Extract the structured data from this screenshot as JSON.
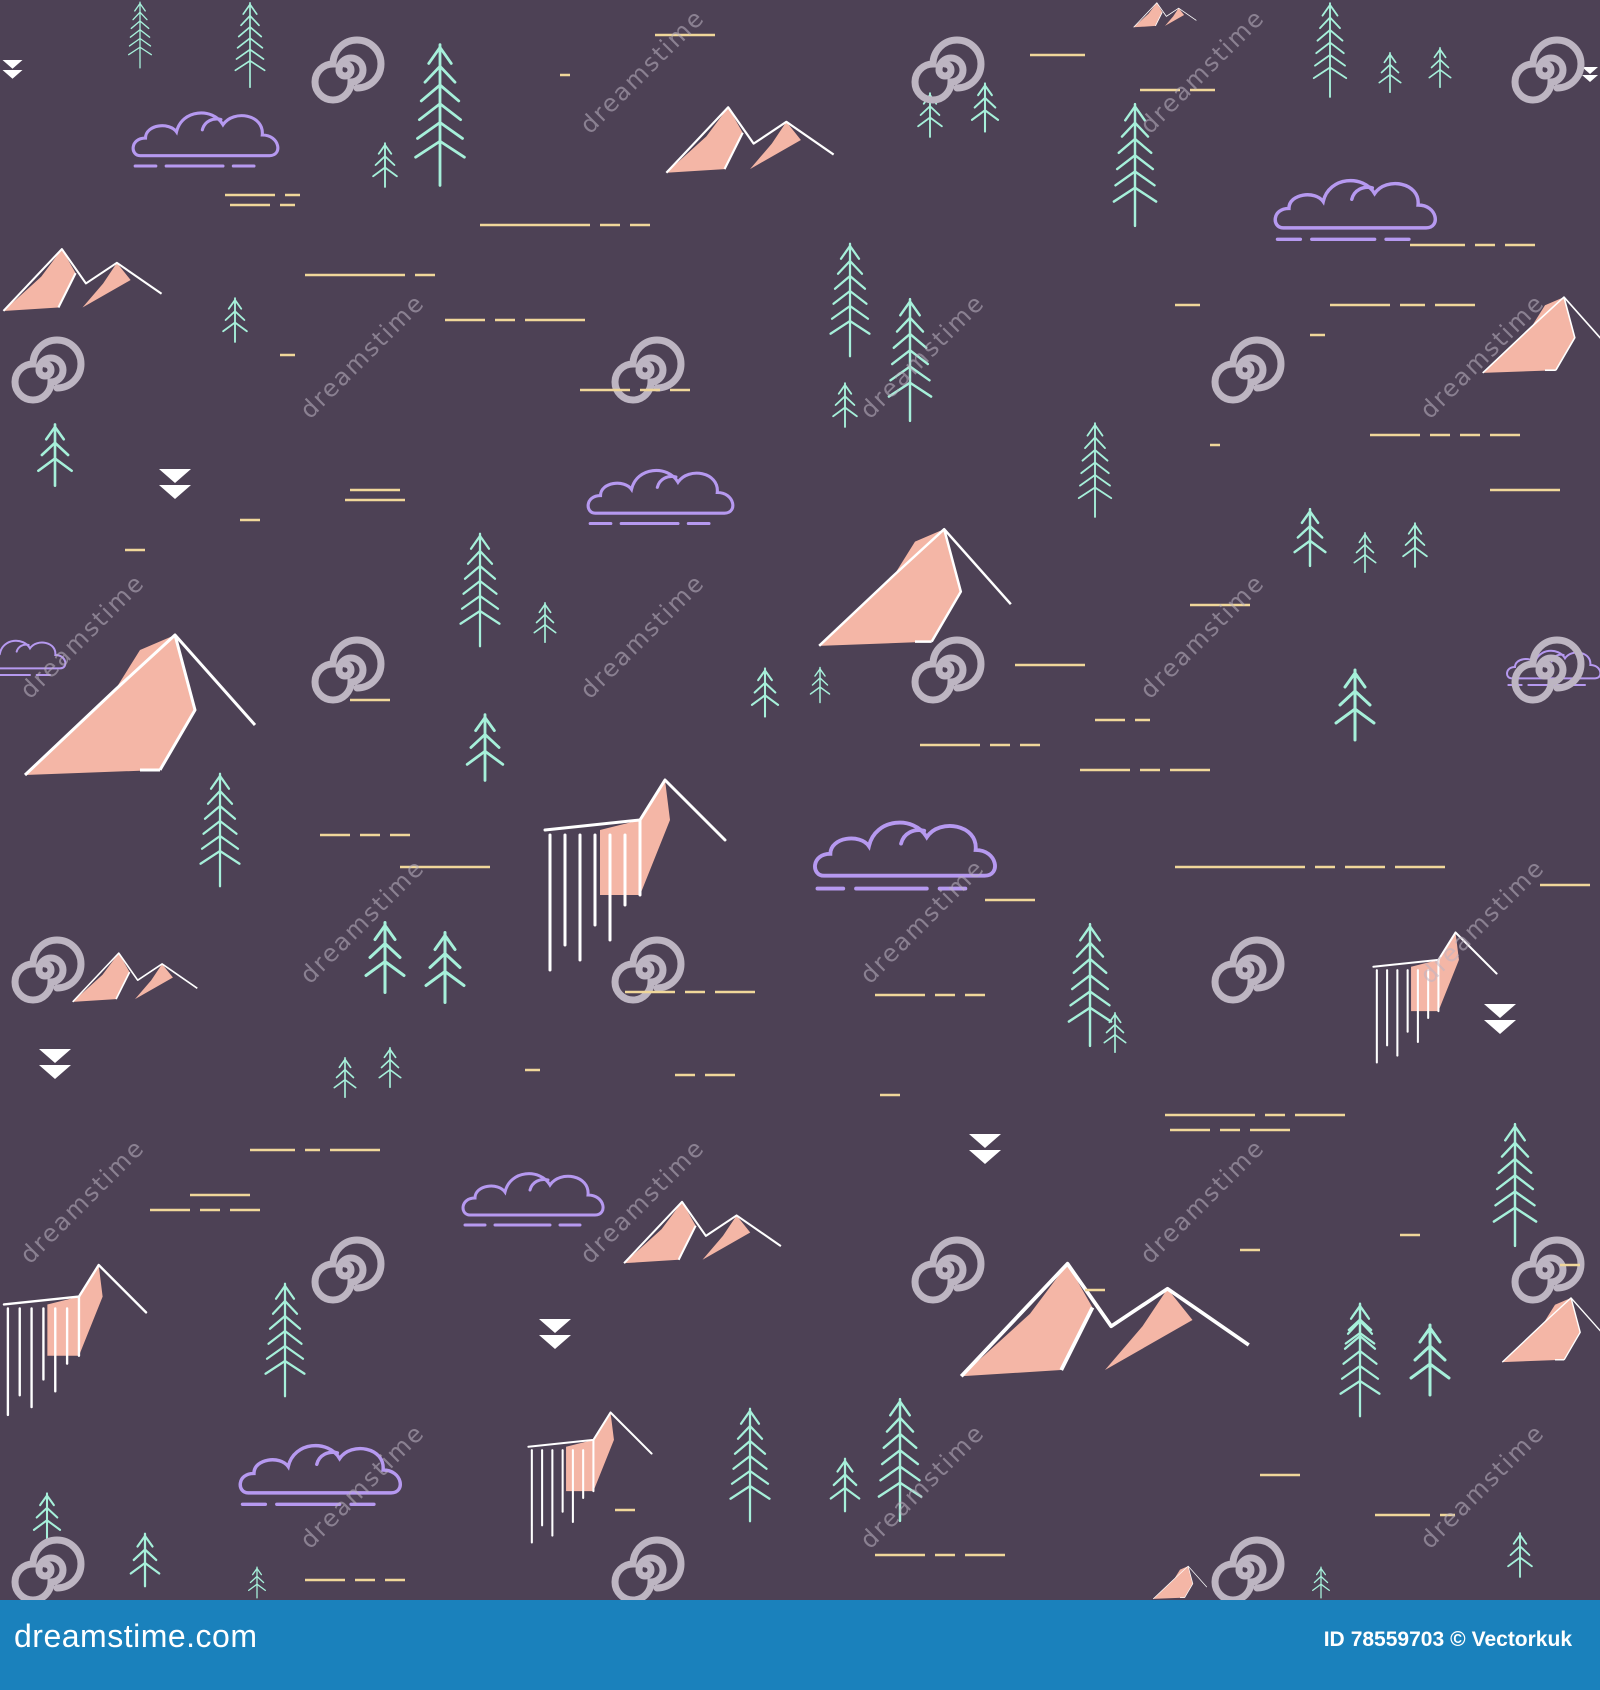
{
  "scene": {
    "background_color": "#4d4155",
    "tree_color": "#a6f0da",
    "mountain_fill": "#f4b6a6",
    "outline_color": "#ffffff",
    "cloud_color": "#b699f0",
    "dash_color": "#f0d79a",
    "watermark_color": "#bdb5c2",
    "icons": [
      "pine-tree-icon",
      "mountain-icon",
      "waterfall-icon",
      "cloud-icon",
      "double-chevron-icon",
      "spiral-watermark-icon"
    ]
  },
  "watermark": {
    "text": "dreamstime"
  },
  "footer": {
    "background_color": "#1a81bc",
    "brand": "dreamstime.com",
    "id_label": "ID",
    "id_value": "78559703",
    "copyright": "©",
    "author": "Vectorkuk"
  }
}
